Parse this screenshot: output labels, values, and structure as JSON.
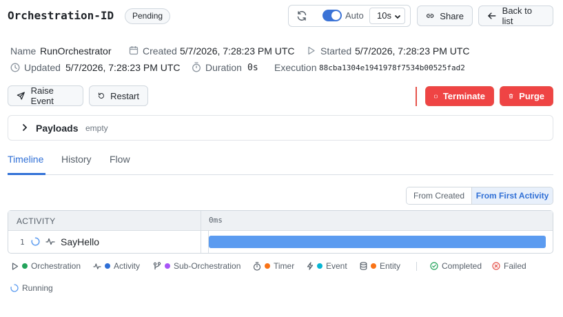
{
  "header": {
    "title": "Orchestration-ID",
    "status": "Pending",
    "auto_label": "Auto",
    "interval": "10s",
    "share_label": "Share",
    "back_label": "Back to list"
  },
  "meta": {
    "name_label": "Name",
    "name_value": "RunOrchestrator",
    "created_label": "Created",
    "created_value": "5/7/2026, 7:28:23 PM UTC",
    "started_label": "Started",
    "started_value": "5/7/2026, 7:28:23 PM UTC",
    "updated_label": "Updated",
    "updated_value": "5/7/2026, 7:28:23 PM UTC",
    "duration_label": "Duration",
    "duration_value": "0s",
    "execution_label": "Execution",
    "execution_value": "88cba1304e1941978f7534b00525fad2"
  },
  "actions": {
    "raise_label": "Raise Event",
    "restart_label": "Restart",
    "terminate_label": "Terminate",
    "purge_label": "Purge"
  },
  "payloads": {
    "label": "Payloads",
    "state": "empty"
  },
  "tabs": [
    {
      "label": "Timeline",
      "active": true
    },
    {
      "label": "History",
      "active": false
    },
    {
      "label": "Flow",
      "active": false
    }
  ],
  "range": {
    "created": "From Created",
    "first": "From First Activity"
  },
  "timeline": {
    "col_activity": "ACTIVITY",
    "col_time": "0ms",
    "rows": [
      {
        "index": "1",
        "name": "SayHello",
        "status": "running",
        "bar_fraction": 1.0
      }
    ]
  },
  "legend": {
    "orchestration": "Orchestration",
    "activity": "Activity",
    "sub_orchestration": "Sub-Orchestration",
    "timer": "Timer",
    "event": "Event",
    "entity": "Entity",
    "completed": "Completed",
    "failed": "Failed",
    "running": "Running"
  },
  "colors": {
    "accent": "#2f6fd6",
    "danger": "#ef4444",
    "bar": "#5b9bf0",
    "orchestration_dot": "#22a35a",
    "activity_dot": "#2f6fd6",
    "sub_orchestration_dot": "#a855f7",
    "timer_dot": "#f97316",
    "event_dot": "#06b6d4",
    "entity_dot": "#f97316"
  }
}
